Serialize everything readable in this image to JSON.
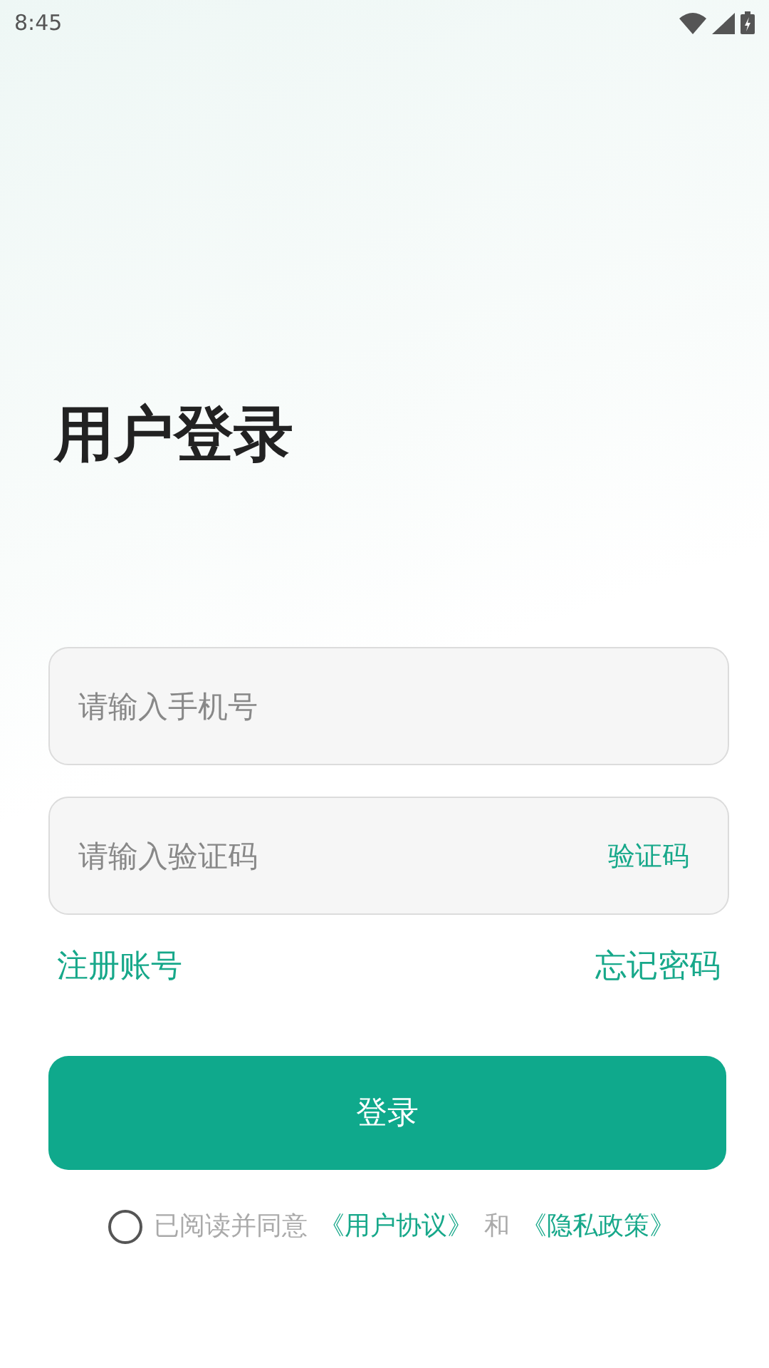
{
  "status_bar": {
    "time": "8:45"
  },
  "title": "用户登录",
  "phone_field": {
    "placeholder": "请输入手机号"
  },
  "code_field": {
    "placeholder": "请输入验证码",
    "action": "验证码"
  },
  "links": [
    "注册账号",
    "忘记密码"
  ],
  "login_button": "登录",
  "agreement": {
    "checked": false,
    "prefix": "已阅读并同意",
    "links": [
      "《用户协议》",
      "《隐私政策》"
    ],
    "joiner": "和"
  }
}
